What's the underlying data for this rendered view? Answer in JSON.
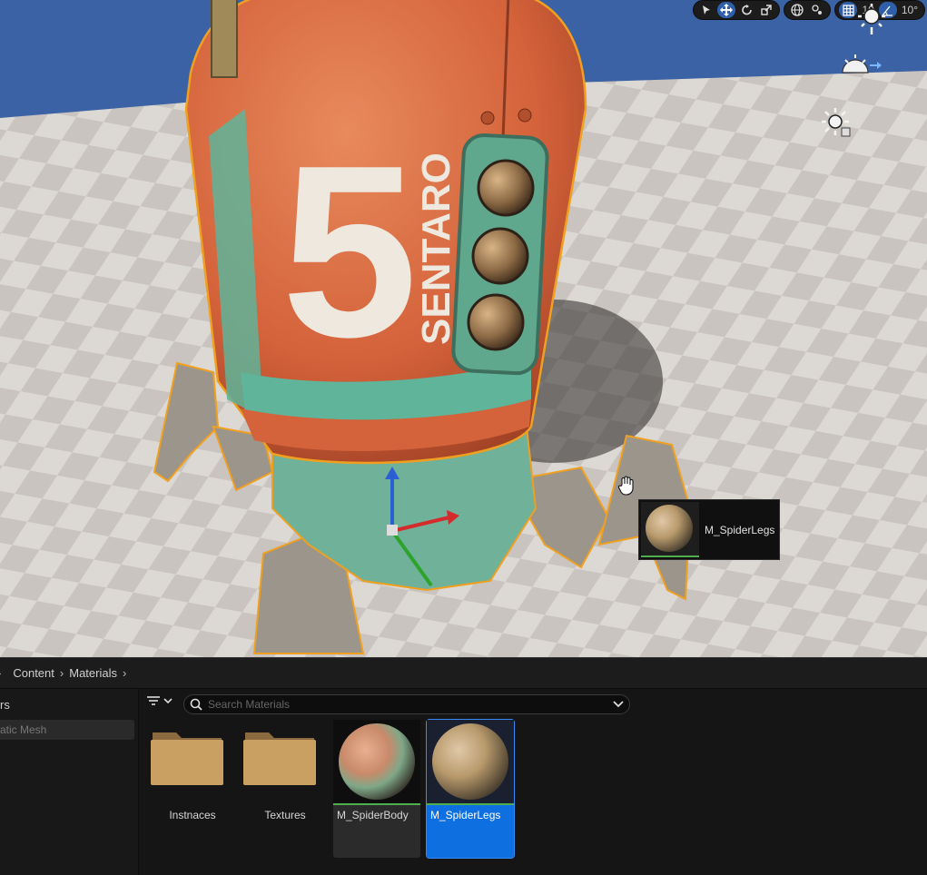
{
  "viewport": {
    "toolbar": {
      "grid_snap_value": "10",
      "rotation_snap_value": "10°"
    },
    "robot_decal": {
      "number": "5",
      "name": "SENTARO"
    },
    "drag_tooltip": {
      "asset_name": "M_SpiderLegs"
    }
  },
  "content_browser": {
    "breadcrumbs": [
      "Content",
      "Materials"
    ],
    "sources_header": "rs",
    "sources_filter": "atic Mesh",
    "search_placeholder": "Search Materials",
    "assets": [
      {
        "name": "Instnaces",
        "type": "folder"
      },
      {
        "name": "Textures",
        "type": "folder"
      },
      {
        "name": "M_SpiderBody",
        "type": "material"
      },
      {
        "name": "M_SpiderLegs",
        "type": "material",
        "selected": true
      }
    ]
  },
  "colors": {
    "accent": "#0e70e0",
    "selection_outline": "#f0a020",
    "sky": "#3c62a6",
    "body_orange": "#d9663a",
    "body_teal": "#5fb49a",
    "material_bar": "#4fae4f"
  }
}
